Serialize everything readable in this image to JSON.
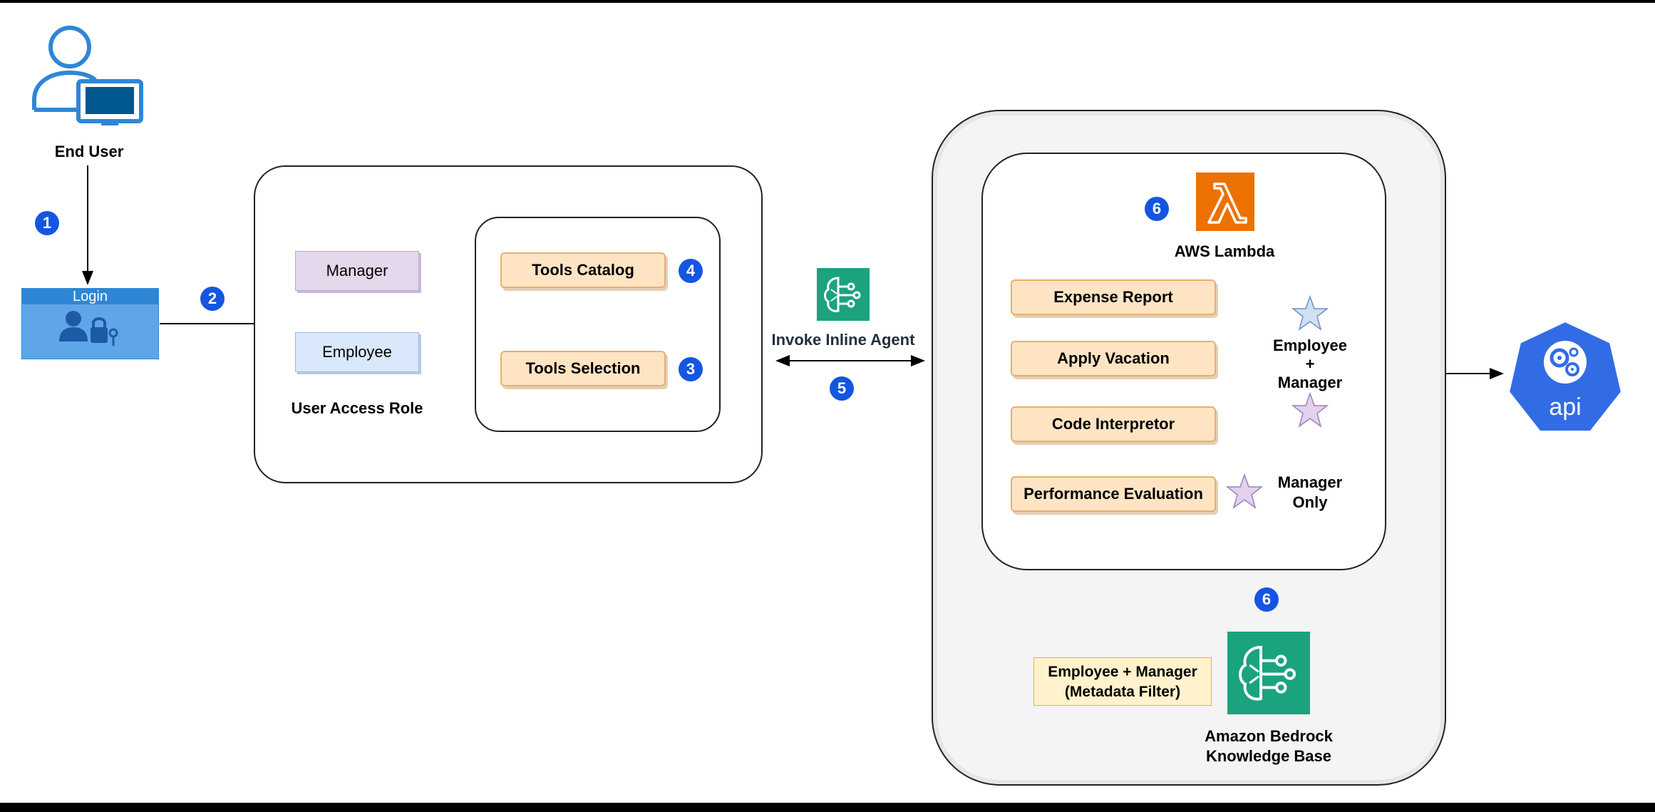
{
  "end_user": {
    "label": "End User"
  },
  "login": {
    "title": "Login"
  },
  "steps": [
    "1",
    "2",
    "3",
    "4",
    "5",
    "6",
    "6"
  ],
  "access": {
    "roles": [
      {
        "label": "Manager"
      },
      {
        "label": "Employee"
      }
    ],
    "title": "User Access Role",
    "tools_catalog": "Tools Catalog",
    "tools_selection": "Tools Selection"
  },
  "agent": {
    "label": "Invoke Inline Agent"
  },
  "lambda": {
    "label": "AWS Lambda",
    "tools": [
      "Expense Report",
      "Apply Vacation",
      "Code Interpretor",
      "Performance Evaluation"
    ],
    "group_label_line1": "Employee",
    "group_label_plus": "+",
    "group_label_line2": "Manager",
    "manager_only_line1": "Manager",
    "manager_only_line2": "Only"
  },
  "knowledge_base": {
    "filter_line1": "Employee + Manager",
    "filter_line2": "(Metadata Filter)",
    "label_line1": "Amazon Bedrock",
    "label_line2": "Knowledge Base"
  },
  "api": {
    "label": "api"
  },
  "colors": {
    "step_badge": "#1556e0",
    "login_blue": "#2f86d6",
    "bedrock_green": "#1aa37e",
    "lambda_orange": "#ed7100",
    "api_blue": "#326ce5",
    "tool_fill": "#ffe4c4",
    "star_blue": "#cfe0f7",
    "star_purple": "#e2d2ee"
  }
}
